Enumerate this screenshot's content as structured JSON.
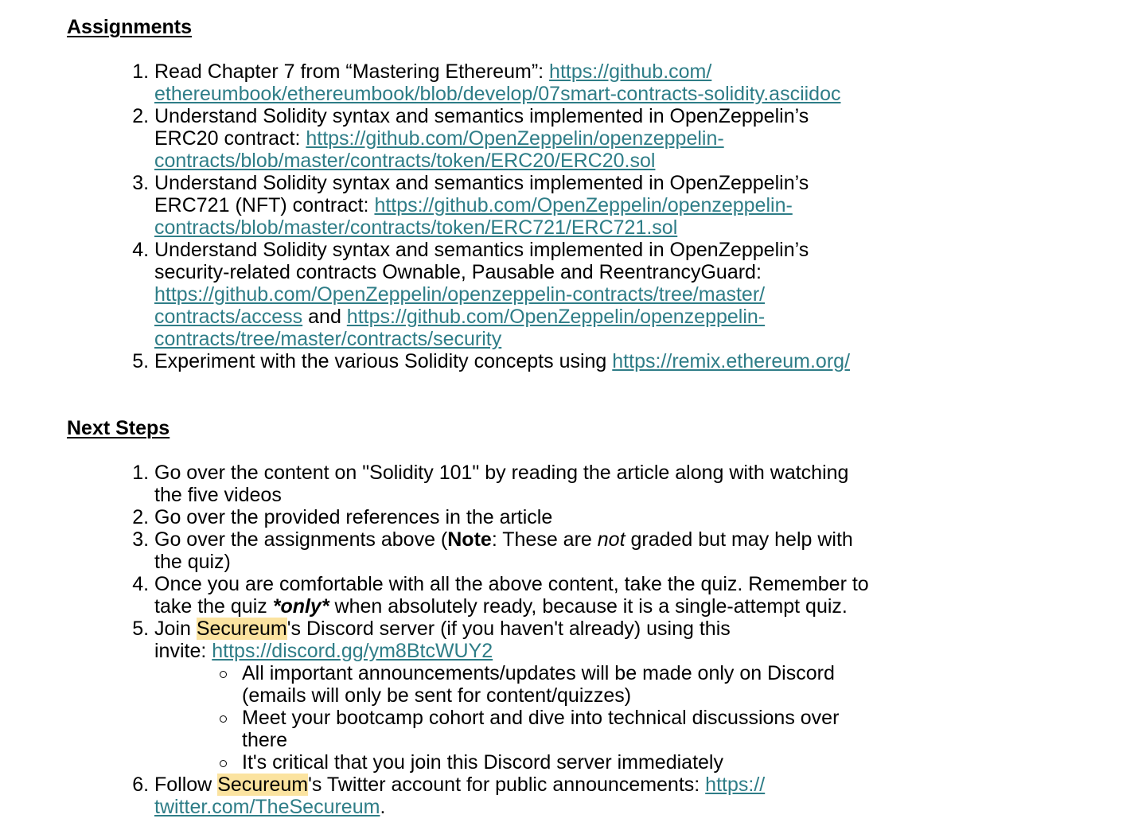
{
  "assignments": {
    "heading": "Assignments",
    "items": [
      {
        "text": "Read Chapter 7 from “Mastering Ethereum”: ",
        "link_line1": "https://github.com/",
        "link_line2": "ethereumbook/ethereumbook/blob/develop/07smart-contracts-solidity.asciidoc"
      },
      {
        "text_line1": "Understand Solidity syntax and semantics implemented in OpenZeppelin’s",
        "text_line2": "ERC20 contract: ",
        "link_line1": "https://github.com/OpenZeppelin/openzeppelin-",
        "link_line2": "contracts/blob/master/contracts/token/ERC20/ERC20.sol"
      },
      {
        "text_line1": "Understand Solidity syntax and semantics implemented in OpenZeppelin’s",
        "text_line2": "ERC721 (NFT) contract: ",
        "link_line1": "https://github.com/OpenZeppelin/openzeppelin-",
        "link_line2": "contracts/blob/master/contracts/token/ERC721/ERC721.sol"
      },
      {
        "text_line1": "Understand Solidity syntax and semantics implemented in OpenZeppelin’s",
        "text_line2": "security-related contracts Ownable, Pausable and ReentrancyGuard:",
        "link1_line1": "https://github.com/OpenZeppelin/openzeppelin-contracts/tree/master/",
        "link1_line2": "contracts/access",
        "joiner": " and ",
        "link2_line1": "https://github.com/OpenZeppelin/openzeppelin-",
        "link2_line2": "contracts/tree/master/contracts/security"
      },
      {
        "text": "Experiment with the various Solidity concepts using ",
        "link": "https://remix.ethereum.org/"
      }
    ]
  },
  "next_steps": {
    "heading": "Next Steps",
    "items": [
      {
        "line1": "Go over the content on \"Solidity 101\" by reading the article along with watching",
        "line2": "the five videos"
      },
      {
        "text": "Go over the provided references in the article"
      },
      {
        "pre": "Go over the assignments above (",
        "bold": "Note",
        "mid": ": These are ",
        "italic": "not",
        "post_line1": " graded but may help with",
        "post_line2": "the quiz)"
      },
      {
        "line1": "Once you are comfortable with all the above content, take the quiz. Remember to",
        "pre": "take the quiz ",
        "emph": "*only*",
        "post": " when absolutely ready, because it is a single-attempt quiz."
      },
      {
        "pre": "Join ",
        "highlight": "Secureum",
        "post_line1": "'s Discord server (if you haven't already) using this",
        "post_line2": "invite: ",
        "link": "https://discord.gg/ym8BtcWUY2",
        "subitems": [
          {
            "line1": "All important announcements/updates will be made only on Discord",
            "line2": "(emails will only be sent for content/quizzes)"
          },
          {
            "line1": "Meet your bootcamp cohort and dive into technical discussions over",
            "line2": "there"
          },
          {
            "line1": "It's critical that you join this Discord server immediately"
          }
        ]
      },
      {
        "pre": "Follow ",
        "highlight": "Secureum",
        "post": "'s Twitter account for public announcements: ",
        "link_line1": "https://",
        "link_line2": "twitter.com/TheSecureum",
        "end": "."
      }
    ]
  }
}
